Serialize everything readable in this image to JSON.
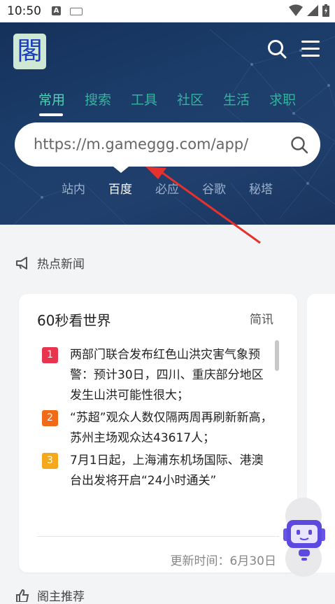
{
  "status_bar": {
    "time": "10:50",
    "a_badge": "A"
  },
  "header": {
    "logo_char": "閣",
    "tabs": [
      "常用",
      "搜索",
      "工具",
      "社区",
      "生活",
      "求职"
    ],
    "active_tab": "常用",
    "search_text": "https://m.gameggg.com/app/",
    "engines": [
      "站内",
      "百度",
      "必应",
      "谷歌",
      "秘塔"
    ],
    "active_engine": "百度"
  },
  "news": {
    "section_title": "热点新闻",
    "card_title": "60秒看世界",
    "card_tag": "简讯",
    "items": [
      {
        "rank": "1",
        "color": "#e8344e",
        "text": "两部门联合发布红色山洪灾害气象预警：预计30日，四川、重庆部分地区发生山洪可能性很大；"
      },
      {
        "rank": "2",
        "color": "#f06a18",
        "text": "“苏超”观众人数仅隔两周再刷新新高，苏州主场观众达43617人；"
      },
      {
        "rank": "3",
        "color": "#f5a81a",
        "text": "7月1日起，上海浦东机场国际、港澳台出发将开启“24小时通关”"
      }
    ],
    "update_label": "更新时间：6月30日"
  },
  "recommend": {
    "title": "阁主推荐"
  },
  "colors": {
    "accent": "#4bd3b4",
    "hero_bg": "#1c3d6a",
    "arrow": "#e8302c"
  }
}
